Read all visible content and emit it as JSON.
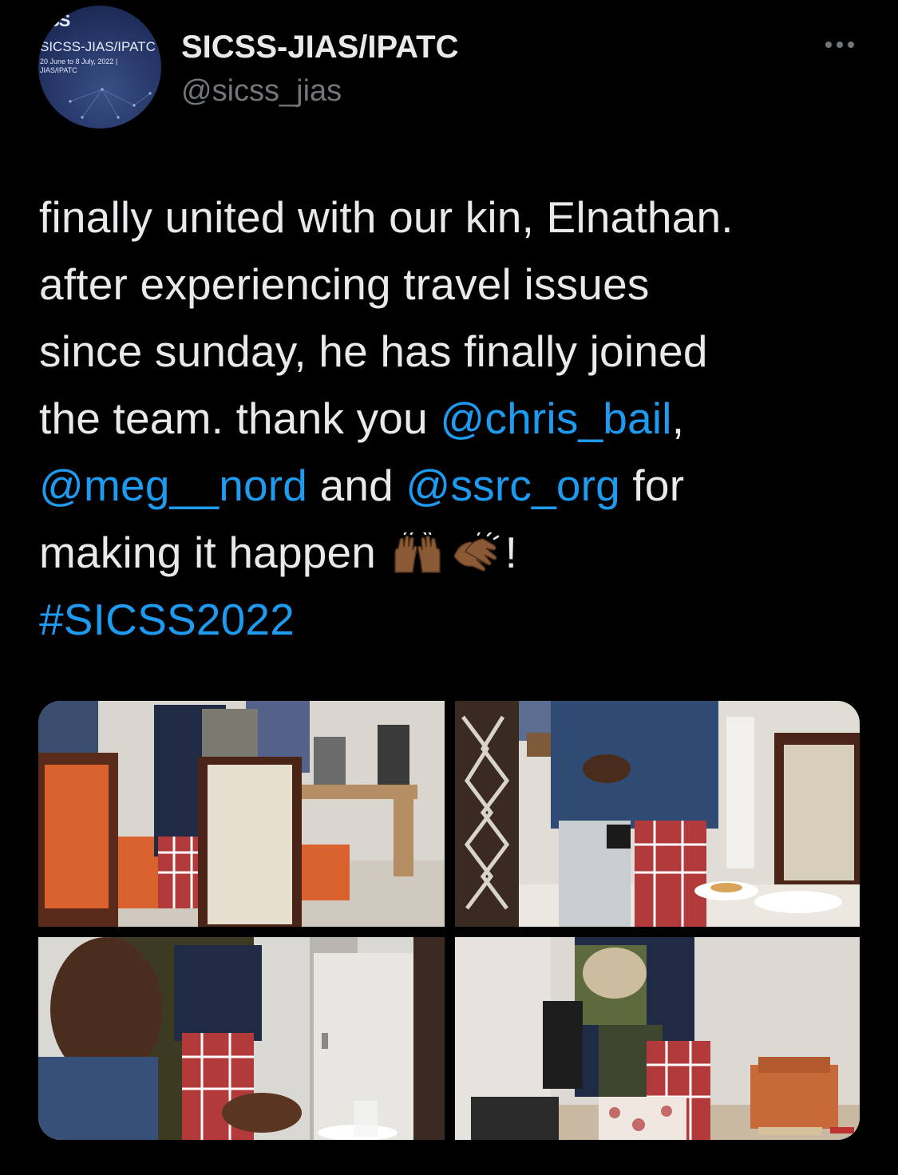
{
  "account": {
    "display_name": "SICSS-JIAS/IPATC",
    "handle": "@sicss_jias",
    "avatar_top": "SS",
    "avatar_name": "SICSS-JIAS/IPATC",
    "avatar_sub": "20 June to 8 July, 2022 |\nJIAS/IPATC"
  },
  "tweet": {
    "line1": "finally united with our kin, Elnathan.",
    "line2": "after experiencing travel issues",
    "line3": "since sunday, he has finally joined",
    "line4_text": "the team. thank you ",
    "mention1": "@chris_bail",
    "line4_end": ",",
    "mention2": "@meg__nord",
    "and_text": " and ",
    "mention3": "@ssrc_org",
    "for_text": " for",
    "line6_text": "making it happen ",
    "emoji1": "raising-hands-emoji",
    "emoji2": "clapping-hands-emoji",
    "exclaim": "!",
    "hashtag": "#SICSS2022"
  },
  "media": [
    {
      "label": "photo-1"
    },
    {
      "label": "photo-2"
    },
    {
      "label": "photo-3"
    },
    {
      "label": "photo-4"
    }
  ],
  "colors": {
    "background": "#000000",
    "text": "#e7e9ea",
    "secondary": "#71767b",
    "link": "#1d9bf0"
  }
}
